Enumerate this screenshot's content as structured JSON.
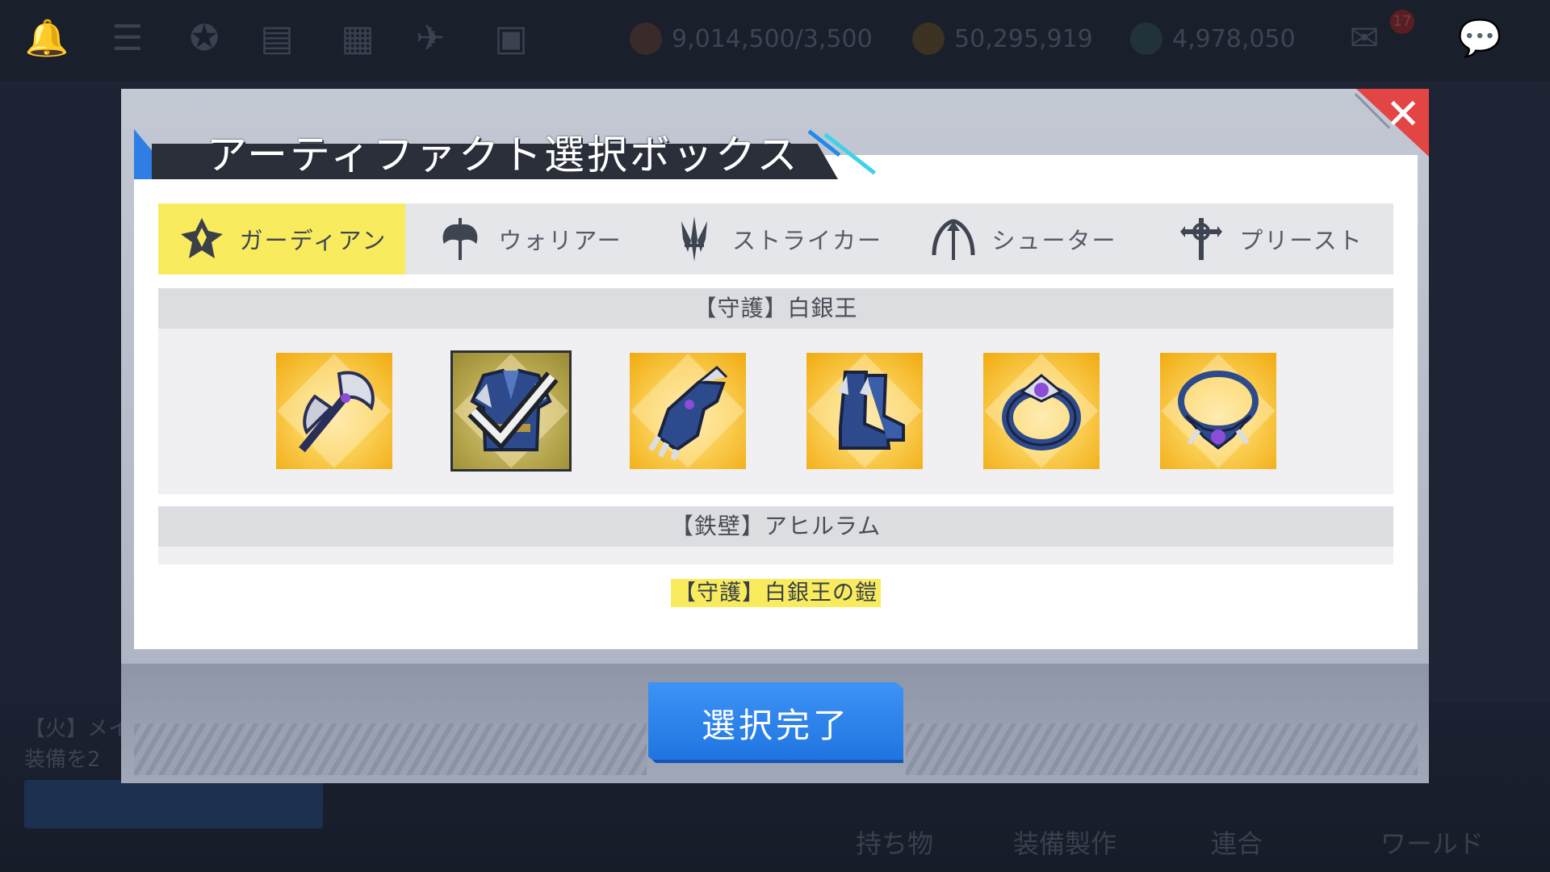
{
  "background": {
    "resources": [
      {
        "name": "stamina",
        "value": "9,014,500/3,500"
      },
      {
        "name": "gold",
        "value": "50,295,919"
      },
      {
        "name": "gem",
        "value": "4,978,050"
      }
    ],
    "mail_badge": "17",
    "bottom_nav": [
      "持ち物",
      "装備製作",
      "連合",
      "ワールド"
    ],
    "left_text": [
      "【火】メイ",
      "装備を2"
    ]
  },
  "dialog": {
    "title": "アーティファクト選択ボックス",
    "close_label": "✕",
    "tabs": [
      {
        "label": "ガーディアン",
        "icon": "guardian-icon",
        "active": true
      },
      {
        "label": "ウォリアー",
        "icon": "warrior-icon",
        "active": false
      },
      {
        "label": "ストライカー",
        "icon": "striker-icon",
        "active": false
      },
      {
        "label": "シューター",
        "icon": "shooter-icon",
        "active": false
      },
      {
        "label": "プリースト",
        "icon": "priest-icon",
        "active": false
      }
    ],
    "sets": [
      {
        "name": "【守護】白銀王",
        "items": [
          {
            "icon": "axe-weapon-icon",
            "selected": false
          },
          {
            "icon": "armor-icon",
            "selected": true
          },
          {
            "icon": "gauntlet-icon",
            "selected": false
          },
          {
            "icon": "boots-icon",
            "selected": false
          },
          {
            "icon": "ring-icon",
            "selected": false
          },
          {
            "icon": "necklace-icon",
            "selected": false
          }
        ]
      },
      {
        "name": "【鉄壁】アヒルラム",
        "items": []
      }
    ],
    "selected_item_name": "【守護】白銀王の鎧",
    "confirm_label": "選択完了"
  }
}
